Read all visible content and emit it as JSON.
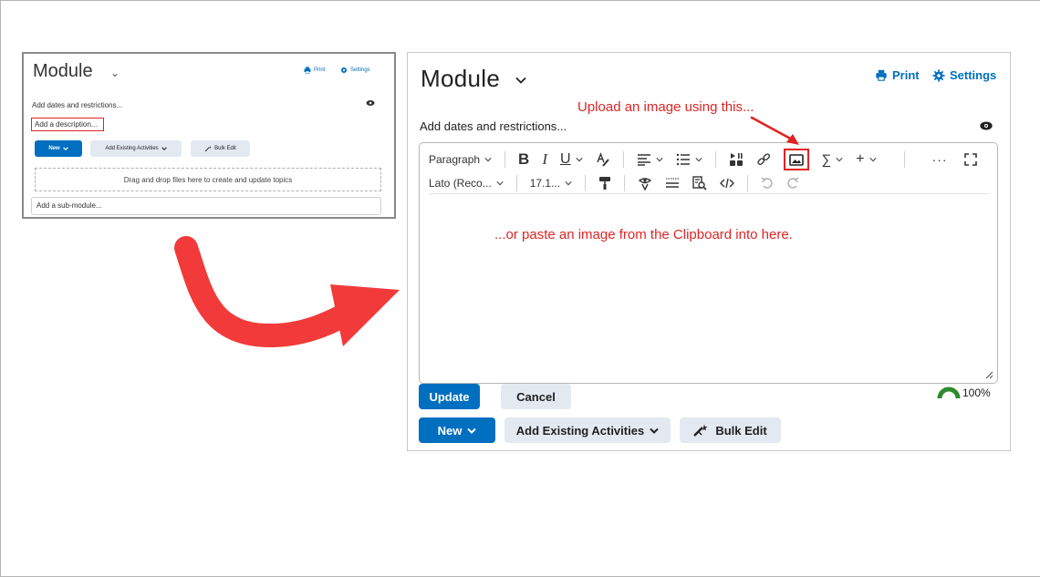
{
  "thumbnail": {
    "title": "Module",
    "print_label": "Print",
    "settings_label": "Settings",
    "dates_text": "Add dates and restrictions...",
    "description_text": "Add a description...",
    "new_label": "New",
    "existing_label": "Add Existing Activities",
    "bulk_label": "Bulk Edit",
    "drop_text": "Drag and drop files here to create and update topics",
    "submodule_text": "Add a sub-module..."
  },
  "panel": {
    "title": "Module",
    "print_label": "Print",
    "settings_label": "Settings",
    "dates_text": "Add dates and restrictions...",
    "upload_note": "Upload an image using this...",
    "toolbar": {
      "paragraph": "Paragraph",
      "bold": "B",
      "italic": "I",
      "underline": "U",
      "font_name": "Lato (Reco...",
      "font_size": "17.1..."
    },
    "paste_note": "...or paste an image from the Clipboard into here.",
    "update_label": "Update",
    "cancel_label": "Cancel",
    "progress_text": "100%",
    "progress_value": 100,
    "new_label": "New",
    "existing_label": "Add Existing Activities",
    "bulk_label": "Bulk Edit"
  },
  "colors": {
    "brand_blue": "#006fbf",
    "annotation_red": "#e02424",
    "button_gray": "#e3e9f1",
    "progress_green": "#2e8b2e"
  }
}
